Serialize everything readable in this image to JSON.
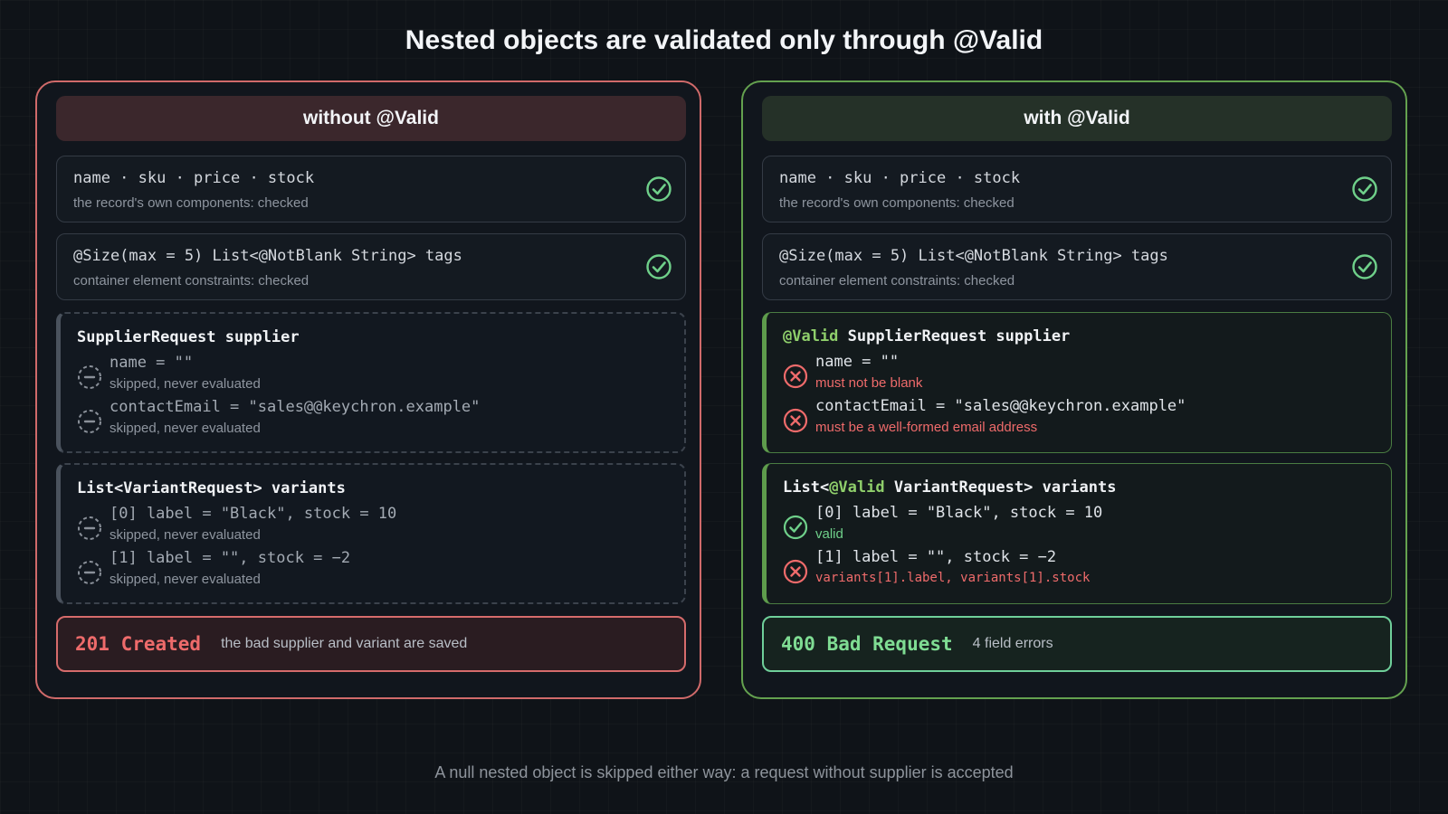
{
  "title": "Nested objects are validated only through @Valid",
  "footer": "A null nested object is skipped either way: a request without supplier is accepted",
  "left_panel": {
    "header": "without @Valid",
    "record_card": {
      "code": "name · sku · price · stock",
      "note": "the record's own components: checked",
      "icon": "check-icon"
    },
    "tags_card": {
      "code": "@Size(max = 5) List<@NotBlank String> tags",
      "note": "container element constraints: checked",
      "icon": "check-icon"
    },
    "supplier": {
      "title": "SupplierRequest supplier",
      "rows": [
        {
          "code": "name = \"\"",
          "note": "skipped, never evaluated",
          "icon": "skipped-icon"
        },
        {
          "code": "contactEmail = \"sales@@keychron.example\"",
          "note": "skipped, never evaluated",
          "icon": "skipped-icon"
        }
      ]
    },
    "variants": {
      "title": "List<VariantRequest> variants",
      "rows": [
        {
          "code": "[0] label = \"Black\", stock = 10",
          "note": "skipped, never evaluated",
          "icon": "skipped-icon"
        },
        {
          "code": "[1] label = \"\", stock = −2",
          "note": "skipped, never evaluated",
          "icon": "skipped-icon"
        }
      ]
    },
    "status": {
      "code": "201 Created",
      "desc": "the bad supplier and variant are saved"
    }
  },
  "right_panel": {
    "header": "with @Valid",
    "record_card": {
      "code": "name · sku · price · stock",
      "note": "the record's own components: checked",
      "icon": "check-icon"
    },
    "tags_card": {
      "code": "@Size(max = 5) List<@NotBlank String> tags",
      "note": "container element constraints: checked",
      "icon": "check-icon"
    },
    "supplier": {
      "title_annotation": "@Valid",
      "title_rest": " SupplierRequest supplier",
      "rows": [
        {
          "code": "name = \"\"",
          "note": "must not be blank",
          "icon": "error-icon"
        },
        {
          "code": "contactEmail = \"sales@@keychron.example\"",
          "note": "must be a well-formed email address",
          "icon": "error-icon"
        }
      ]
    },
    "variants": {
      "title_prefix": "List<",
      "title_annotation": "@Valid",
      "title_rest": " VariantRequest> variants",
      "rows": [
        {
          "code": "[0] label = \"Black\", stock = 10",
          "note": "valid",
          "icon": "check-icon"
        },
        {
          "code": "[1] label = \"\", stock = −2",
          "note": "variants[1].label, variants[1].stock",
          "icon": "error-icon"
        }
      ]
    },
    "status": {
      "code": "400 Bad Request",
      "desc": "4 field errors"
    }
  },
  "colors": {
    "left_accent": "#d06a6a",
    "right_accent": "#64a14f",
    "check": "#6fd08a",
    "error": "#ef6b6b",
    "skipped": "#8a9099"
  }
}
